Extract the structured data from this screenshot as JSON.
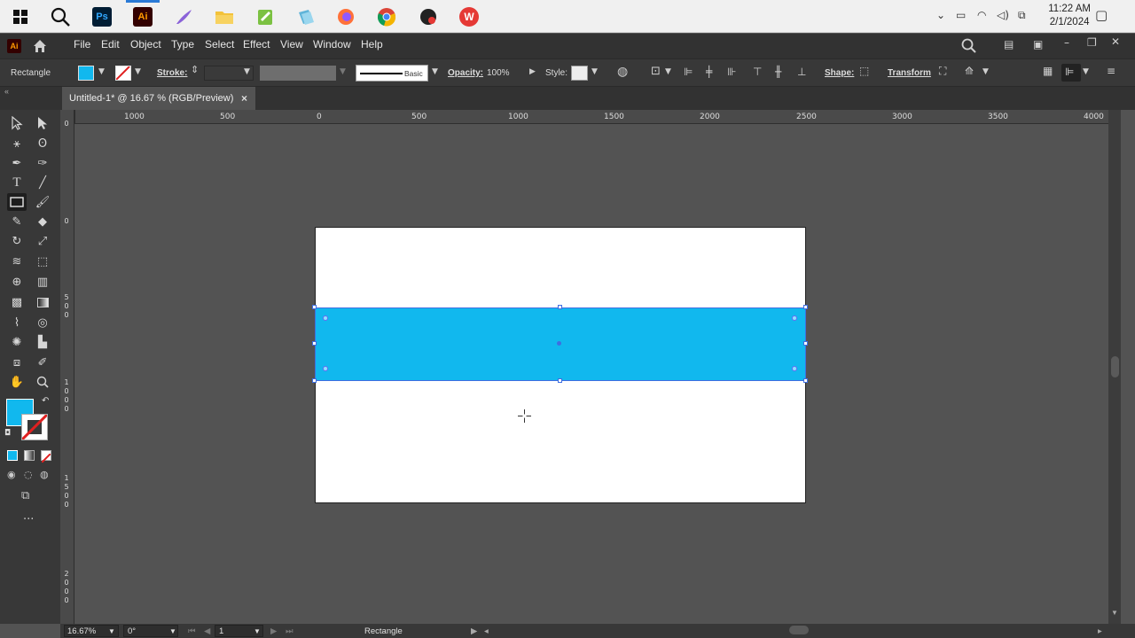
{
  "taskbar": {
    "apps": [
      {
        "name": "windows-start",
        "label": ""
      },
      {
        "name": "search",
        "label": ""
      },
      {
        "name": "photoshop",
        "label": "Ps"
      },
      {
        "name": "illustrator",
        "label": "Ai"
      },
      {
        "name": "feather",
        "label": ""
      },
      {
        "name": "file-explorer",
        "label": ""
      },
      {
        "name": "notepad-plus",
        "label": ""
      },
      {
        "name": "folder-blue",
        "label": ""
      },
      {
        "name": "firefox",
        "label": ""
      },
      {
        "name": "chrome",
        "label": ""
      },
      {
        "name": "recorder",
        "label": ""
      },
      {
        "name": "wps-office",
        "label": "W"
      }
    ],
    "time": "11:22 AM",
    "date": "2/1/2024"
  },
  "menubar": {
    "app_badge": "Ai",
    "items": [
      "File",
      "Edit",
      "Object",
      "Type",
      "Select",
      "Effect",
      "View",
      "Window",
      "Help"
    ]
  },
  "control": {
    "tool_name": "Rectangle",
    "stroke_label": "Stroke:",
    "brush_label": "Basic",
    "opacity_label": "Opacity:",
    "opacity_value": "100%",
    "style_label": "Style:",
    "shape_label": "Shape:",
    "transform_label": "Transform",
    "fill_color": "#11b8ee"
  },
  "document": {
    "tab_title": "Untitled-1* @ 16.67 % (RGB/Preview)",
    "close_glyph": "×"
  },
  "ruler": {
    "h_ticks": [
      "1000",
      "500",
      "0",
      "500",
      "1000",
      "1500",
      "2000",
      "2500",
      "3000",
      "3500",
      "4000"
    ],
    "v_ticks": [
      "0",
      "0",
      "5",
      "0",
      "0",
      "1",
      "0",
      "0",
      "0",
      "1",
      "5",
      "0",
      "0",
      "2",
      "0",
      "0",
      "0"
    ]
  },
  "colors": {
    "fill": "#11b8ee",
    "stroke": "none",
    "selection": "#3f6de0",
    "canvas": "#535353",
    "ui_dark": "#323232"
  },
  "status": {
    "zoom": "16.67%",
    "rotation": "0°",
    "artboard_num": "1",
    "tool": "Rectangle"
  }
}
